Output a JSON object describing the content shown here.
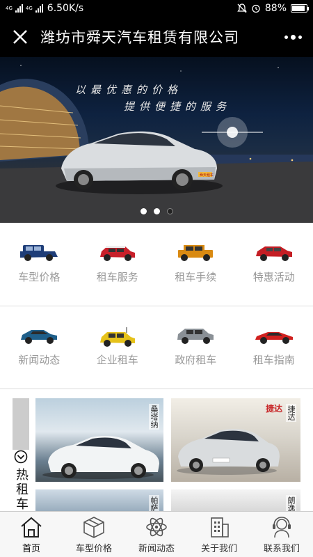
{
  "status_bar": {
    "net_type_a": "4G",
    "net_type_b": "4G",
    "speed": "6.50K/s",
    "battery": "88%",
    "battery_level": 0.88
  },
  "header": {
    "title": "潍坊市舜天汽车租赁有限公司"
  },
  "banner": {
    "line1": "以最优惠的价格",
    "line2": "提供便捷的服务",
    "plate": "舜天租车",
    "slide_count": 3,
    "active_slide": 1
  },
  "grid_row_1": [
    {
      "label": "车型价格",
      "icon": "suv-blue-icon",
      "color": "#1e3d78"
    },
    {
      "label": "租车服务",
      "icon": "mini-red-icon",
      "color": "#c8202a"
    },
    {
      "label": "租车手续",
      "icon": "hummer-orange-icon",
      "color": "#d98a12"
    },
    {
      "label": "特惠活动",
      "icon": "crossover-red-icon",
      "color": "#c41e24"
    }
  ],
  "grid_row_2": [
    {
      "label": "新闻动态",
      "icon": "coupe-blue-icon",
      "color": "#1f5f8a"
    },
    {
      "label": "企业租车",
      "icon": "mini-yellow-icon",
      "color": "#e6c21a"
    },
    {
      "label": "政府租车",
      "icon": "suv-silver-icon",
      "color": "#8a9096"
    },
    {
      "label": "租车指南",
      "icon": "sportscar-red-icon",
      "color": "#d0201e"
    }
  ],
  "hot_section": {
    "side_label": "热租车",
    "cards": [
      {
        "tag": "桑塔纳"
      },
      {
        "tag": "捷达",
        "brand": "捷达"
      },
      {
        "tag": "帕萨"
      },
      {
        "tag": "朗逸"
      }
    ]
  },
  "bottom_nav": [
    {
      "label": "首页",
      "icon": "home-icon"
    },
    {
      "label": "车型价格",
      "icon": "cube-icon"
    },
    {
      "label": "新闻动态",
      "icon": "atom-icon"
    },
    {
      "label": "关于我们",
      "icon": "building-icon"
    },
    {
      "label": "联系我们",
      "icon": "headset-icon"
    }
  ]
}
